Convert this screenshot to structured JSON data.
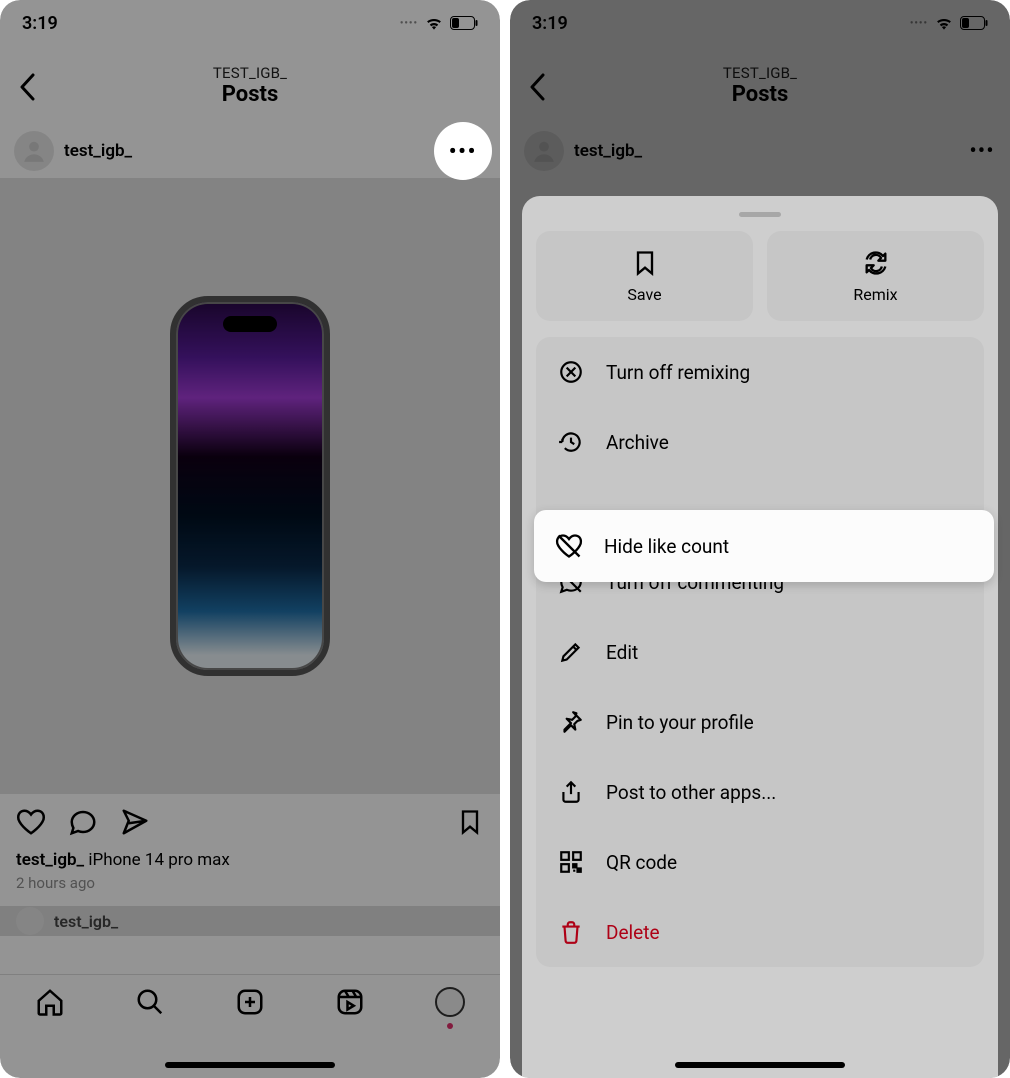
{
  "status": {
    "time": "3:19",
    "battery": "23"
  },
  "nav": {
    "account": "TEST_IGB_",
    "title": "Posts"
  },
  "post": {
    "username": "test_igb_",
    "caption_user": "test_igb_",
    "caption_text": "iPhone 14 pro max",
    "time_ago": "2 hours ago",
    "next_user": "test_igb_"
  },
  "sheet": {
    "buttons": {
      "save": "Save",
      "remix": "Remix"
    },
    "items": {
      "remixing": "Turn off remixing",
      "archive": "Archive",
      "hide_likes": "Hide like count",
      "commenting": "Turn off commenting",
      "edit": "Edit",
      "pin": "Pin to your profile",
      "post_other": "Post to other apps...",
      "qr": "QR code",
      "delete": "Delete"
    }
  }
}
